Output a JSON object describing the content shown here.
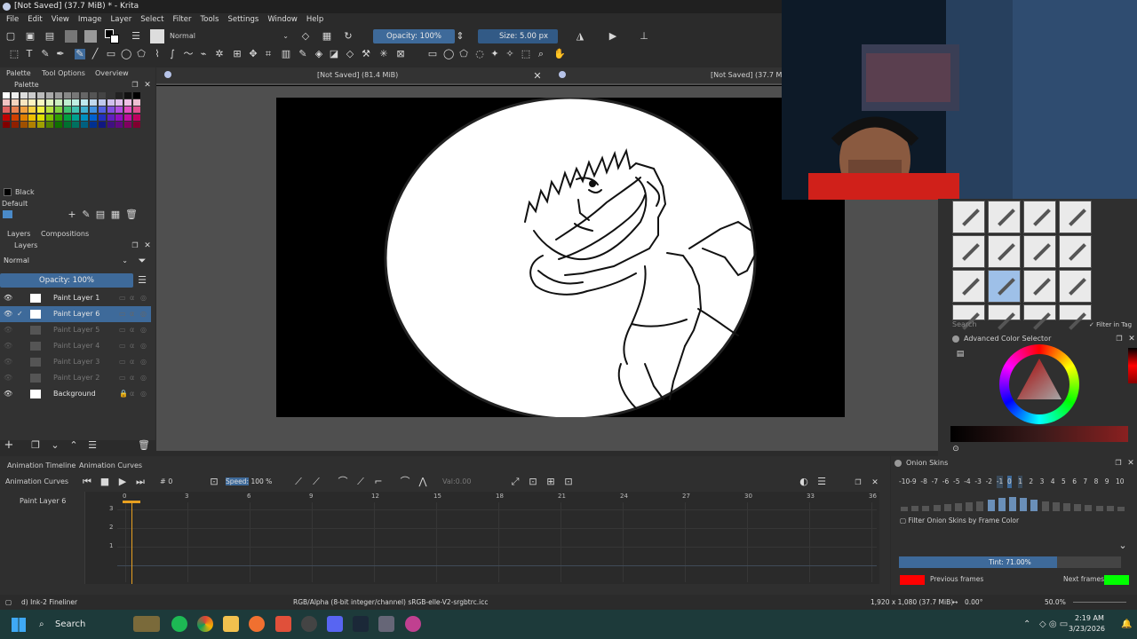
{
  "window": {
    "title": "[Not Saved] (37.7 MiB) * - Krita"
  },
  "menu": [
    "File",
    "Edit",
    "View",
    "Image",
    "Layer",
    "Select",
    "Filter",
    "Tools",
    "Settings",
    "Window",
    "Help"
  ],
  "toolbar": {
    "blend_mode": "Normal",
    "opacity": "Opacity: 100%",
    "size": "Size: 5.00 px"
  },
  "dockers": {
    "tabs": [
      "Palette",
      "Tool Options",
      "Overview"
    ],
    "palette_title": "Palette",
    "color_name": "Black",
    "palette_name": "Default"
  },
  "layers": {
    "tabs": [
      "Layers",
      "Compositions"
    ],
    "title": "Layers",
    "blend": "Normal",
    "opacity": "Opacity: 100%",
    "items": [
      {
        "name": "Paint Layer 1",
        "visible": true
      },
      {
        "name": "Paint Layer 6",
        "visible": true,
        "selected": true
      },
      {
        "name": "Paint Layer 5"
      },
      {
        "name": "Paint Layer 4"
      },
      {
        "name": "Paint Layer 3"
      },
      {
        "name": "Paint Layer 2"
      },
      {
        "name": "Background",
        "visible": true,
        "locked": true
      }
    ]
  },
  "canvas": {
    "tab1": "[Not Saved]  (81.4 MiB)",
    "tab2": "[Not Saved]  (37.7 MiB)"
  },
  "animation": {
    "tabs": [
      "Animation Timeline",
      "Animation Curves"
    ],
    "panel_label": "Animation Curves",
    "frame": "# 0",
    "speed_label": "Speed:",
    "speed": "100 %",
    "value": "Val:0.00",
    "channel": "Paint Layer 6",
    "frame_ticks": [
      "0",
      "3",
      "6",
      "9",
      "12",
      "15",
      "18",
      "21",
      "24",
      "27",
      "30",
      "33",
      "36"
    ],
    "y_ticks": [
      "3",
      "2",
      "1"
    ]
  },
  "onion": {
    "title": "Onion Skins",
    "numbers": [
      "-10",
      "-9",
      "-8",
      "-7",
      "-6",
      "-5",
      "-4",
      "-3",
      "-2",
      "-1",
      "0",
      "1",
      "2",
      "3",
      "4",
      "5",
      "6",
      "7",
      "8",
      "9",
      "10"
    ],
    "filter": "Filter Onion Skins by Frame Color",
    "tint": "Tint: 71.00%",
    "tint_level": 0.71,
    "prev": "Previous frames",
    "next": "Next frames",
    "prev_color": "#ff0000",
    "next_color": "#00ff00"
  },
  "brushes": {
    "search": "Search",
    "filter_tag": "Filter in Tag"
  },
  "color_selector": {
    "title": "Advanced Color Selector"
  },
  "status": {
    "brush": "d) Ink-2 Fineliner",
    "color_space": "RGB/Alpha (8-bit integer/channel)  sRGB-elle-V2-srgbtrc.icc",
    "dims": "1,920 x 1,080 (37.7 MiB)",
    "rotation": "0.00°",
    "zoom": "50.0%"
  },
  "taskbar": {
    "search": "Search",
    "time": "2:19 AM",
    "date": "3/23/2026"
  }
}
